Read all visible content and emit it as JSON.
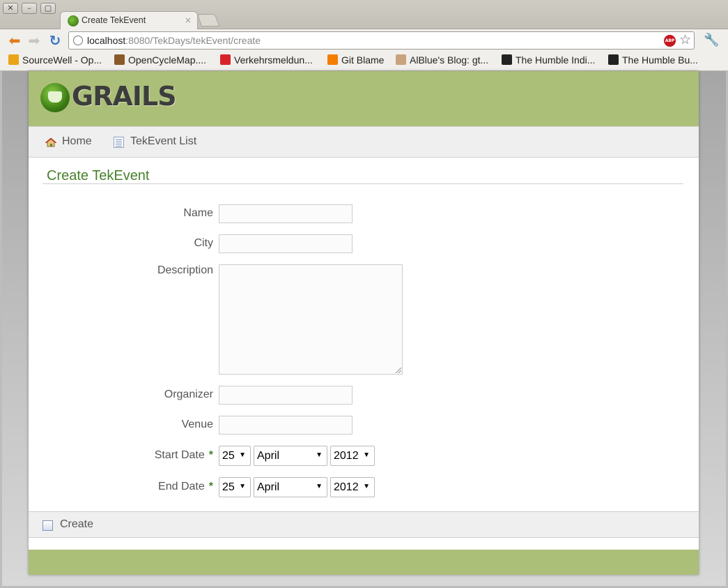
{
  "window": {
    "close_glyph": "✕",
    "minimize_glyph": "–",
    "maximize_glyph": "▢"
  },
  "tab": {
    "title": "Create TekEvent",
    "close_glyph": "×"
  },
  "toolbar": {
    "back_glyph": "⬅",
    "forward_glyph": "➡",
    "reload_glyph": "↻",
    "url_host": "localhost",
    "url_rest": ":8080/TekDays/tekEvent/create",
    "abp_label": "ABP",
    "star_glyph": "☆",
    "wrench_glyph": "🔧"
  },
  "bookmarks": [
    {
      "label": "SourceWell - Op...",
      "icon_color": "#e8a317"
    },
    {
      "label": "OpenCycleMap....",
      "icon_color": "#8a5a2b"
    },
    {
      "label": "Verkehrsmeldun...",
      "icon_color": "#d8232a"
    },
    {
      "label": "Git Blame",
      "icon_color": "#f57d00"
    },
    {
      "label": "AlBlue's Blog: gt...",
      "icon_color": "#c9a27e"
    },
    {
      "label": "The Humble Indi...",
      "icon_color": "#222222"
    },
    {
      "label": "The Humble Bu...",
      "icon_color": "#222222"
    }
  ],
  "header": {
    "logo_text": "GRAILS",
    "brand_color": "#abbf78"
  },
  "nav": {
    "home": "Home",
    "list": "TekEvent List"
  },
  "page": {
    "heading": "Create TekEvent",
    "heading_color": "#48802c"
  },
  "form": {
    "name_label": "Name",
    "city_label": "City",
    "description_label": "Description",
    "organizer_label": "Organizer",
    "venue_label": "Venue",
    "start_date_label": "Start Date",
    "end_date_label": "End Date",
    "required_marker": "*",
    "name_value": "",
    "city_value": "",
    "description_value": "",
    "organizer_value": "",
    "venue_value": "",
    "start_date": {
      "day": "25",
      "month": "April",
      "year": "2012"
    },
    "end_date": {
      "day": "25",
      "month": "April",
      "year": "2012"
    },
    "arrow_glyph": "▼"
  },
  "actions": {
    "create_label": "Create"
  }
}
